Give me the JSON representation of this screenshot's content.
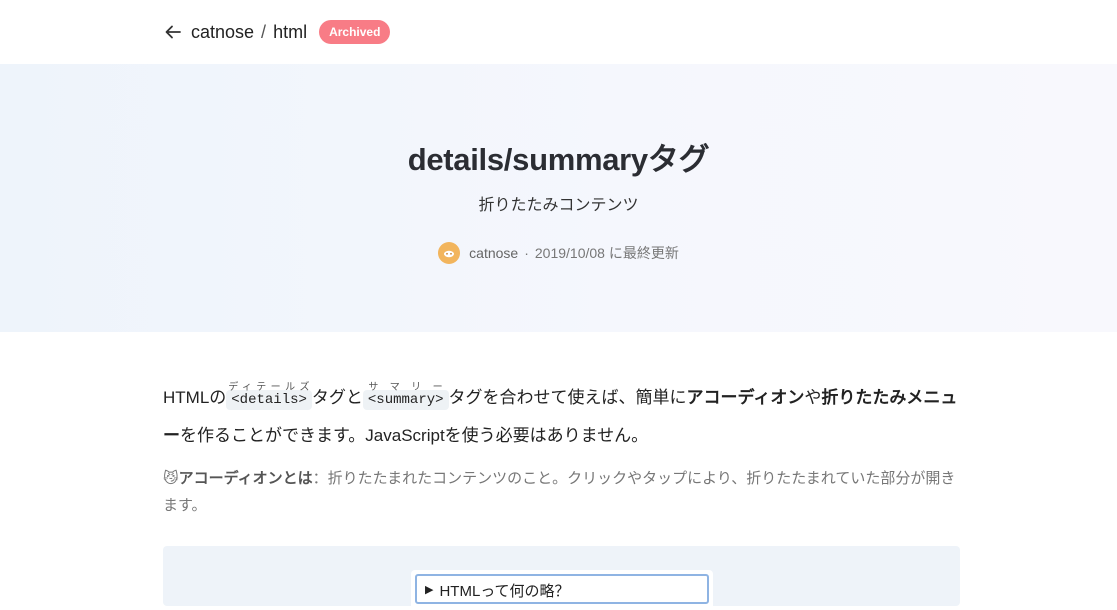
{
  "breadcrumb": {
    "user": "catnose",
    "separator": "/",
    "topic": "html",
    "badge": "Archived"
  },
  "hero": {
    "title": "details/summaryタグ",
    "subtitle": "折りたたみコンテンツ",
    "author": "catnose",
    "meta_separator": "·",
    "updated": "2019/10/08 に最終更新"
  },
  "article": {
    "lead": {
      "p1": "HTMLの",
      "code1": "<details>",
      "ruby1": "ディテールズ",
      "p2": "タグと",
      "code2": "<summary>",
      "ruby2": "サマリー",
      "p3": "タグを合わせて使えば、簡単に",
      "bold1": "アコーディオン",
      "p4": "や",
      "bold2": "折りたたみメニュー",
      "p5": "を作ることができます。JavaScriptを使う必要はありません。"
    },
    "note": {
      "emoji": "😼",
      "term": "アコーディオンとは",
      "text": "：折りたたまれたコンテンツのこと。クリックやタップにより、折りたたまれていた部分が開きます。"
    },
    "demo": {
      "triangle": "▶",
      "summary": "HTMLって何の略？"
    }
  },
  "colors": {
    "badge": "#f87c86",
    "avatar": "#f2b55d",
    "hero_bg": "#f2f5fc",
    "demo_border": "#8fb4e3"
  }
}
